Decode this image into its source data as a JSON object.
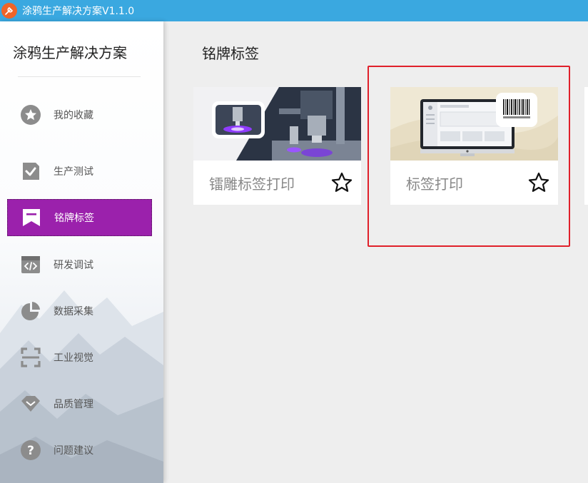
{
  "window": {
    "title": "涂鸦生产解决方案V1.1.0"
  },
  "sidebar": {
    "brand": "涂鸦生产解决方案",
    "items": [
      {
        "label": "我的收藏",
        "icon": "star-circle-icon",
        "active": false
      },
      {
        "label": "生产测试",
        "icon": "check-document-icon",
        "active": false
      },
      {
        "label": "铭牌标签",
        "icon": "bookmark-icon",
        "active": true
      },
      {
        "label": "研发调试",
        "icon": "code-icon",
        "active": false
      },
      {
        "label": "数据采集",
        "icon": "pie-chart-icon",
        "active": false
      },
      {
        "label": "工业视觉",
        "icon": "scan-frame-icon",
        "active": false
      },
      {
        "label": "品质管理",
        "icon": "diamond-icon",
        "active": false
      },
      {
        "label": "问题建议",
        "icon": "question-icon",
        "active": false
      }
    ]
  },
  "main": {
    "section_title": "铭牌标签",
    "cards": [
      {
        "label": "镭雕标签打印",
        "icon": "star-outline-icon"
      },
      {
        "label": "标签打印",
        "icon": "star-outline-icon"
      }
    ]
  },
  "colors": {
    "titlebar": "#3aa8e0",
    "active_nav": "#9b21ac",
    "highlight": "#e0202a",
    "logo": "#ef6428"
  }
}
